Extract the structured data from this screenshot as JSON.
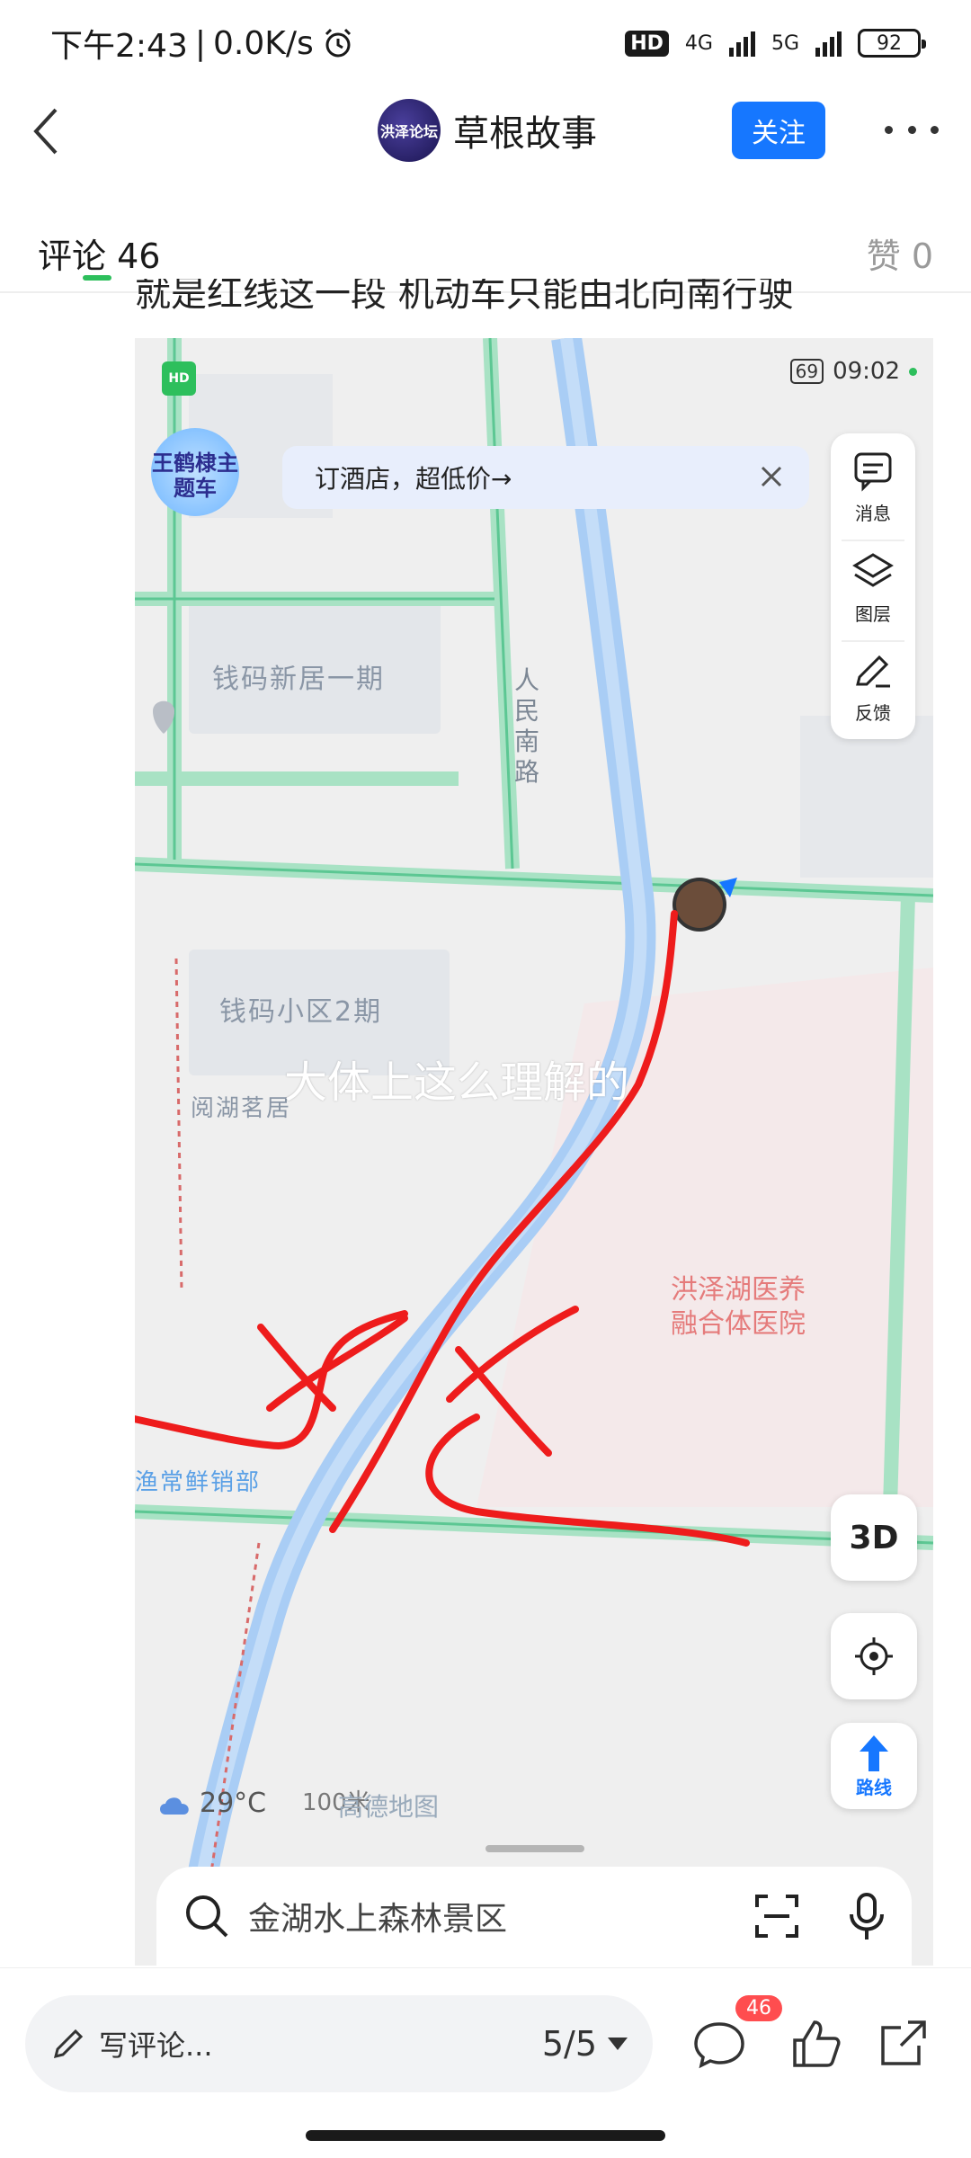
{
  "status_bar": {
    "time": "下午2:43",
    "net_speed": "0.0K/s",
    "hd": "HD",
    "net1": "4G",
    "net2": "5G",
    "battery": "92"
  },
  "header": {
    "back_icon": "chevron-left-icon",
    "avatar_text": "洪泽论坛",
    "title": "草根故事",
    "follow_label": "关注",
    "more_icon": "more-dots-icon"
  },
  "tabs": {
    "comments_label": "评论 46",
    "likes_label": "赞 0",
    "accent_color": "#2dbf5c"
  },
  "post": {
    "text": "就是红线这一段 机动车只能由北向南行驶"
  },
  "map_image": {
    "status_time": "09:02",
    "battery": "69",
    "hd_label": "HD",
    "logo_text": "王鹤棣主题车",
    "ad_text": "订酒店，超低价→",
    "side_panel": [
      {
        "label": "消息",
        "icon": "message-icon"
      },
      {
        "label": "图层",
        "icon": "layers-icon"
      },
      {
        "label": "反馈",
        "icon": "feedback-pen-icon"
      }
    ],
    "places": {
      "p1": "钱码新居一期",
      "p2": "钱码小区2期",
      "p3": "阅湖茗居",
      "road": "人民南路",
      "hospital_line1": "洪泽湖医养",
      "hospital_line2": "融合体医院",
      "shop": "渔常鲜销部"
    },
    "caption": "大体上这么理解的",
    "btn_3d": "3D",
    "btn_route": "路线",
    "weather": "29°C",
    "scale": "100米",
    "map_brand": "高德地图",
    "search_placeholder": "金湖水上森林景区"
  },
  "bottom_bar": {
    "comment_placeholder": "写评论...",
    "pager": "5/5",
    "comment_count_badge": "46",
    "icons": [
      "comment-icon",
      "like-icon",
      "share-icon"
    ]
  }
}
